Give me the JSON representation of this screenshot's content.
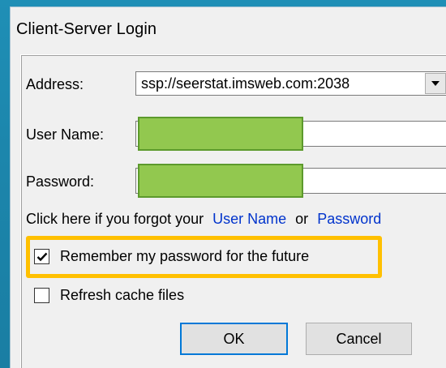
{
  "dialog": {
    "title": "Client-Server Login"
  },
  "form": {
    "address_label": "Address:",
    "address_value": "ssp://seerstat.imsweb.com:2038",
    "username_label": "User Name:",
    "password_label": "Password:"
  },
  "forgot": {
    "prefix": "Click here if you forgot your",
    "username_link": "User Name",
    "or": "or",
    "password_link": "Password"
  },
  "options": {
    "remember_label": "Remember my password for the future",
    "remember_checked": true,
    "refresh_label": "Refresh cache files",
    "refresh_checked": false
  },
  "buttons": {
    "ok_label": "OK",
    "cancel_label": "Cancel"
  },
  "colors": {
    "link": "#0033cc",
    "highlight": "#ffc000",
    "redaction": "#92c84f"
  },
  "icons": {
    "dropdown": "chevron-down-icon",
    "check": "check-icon"
  }
}
